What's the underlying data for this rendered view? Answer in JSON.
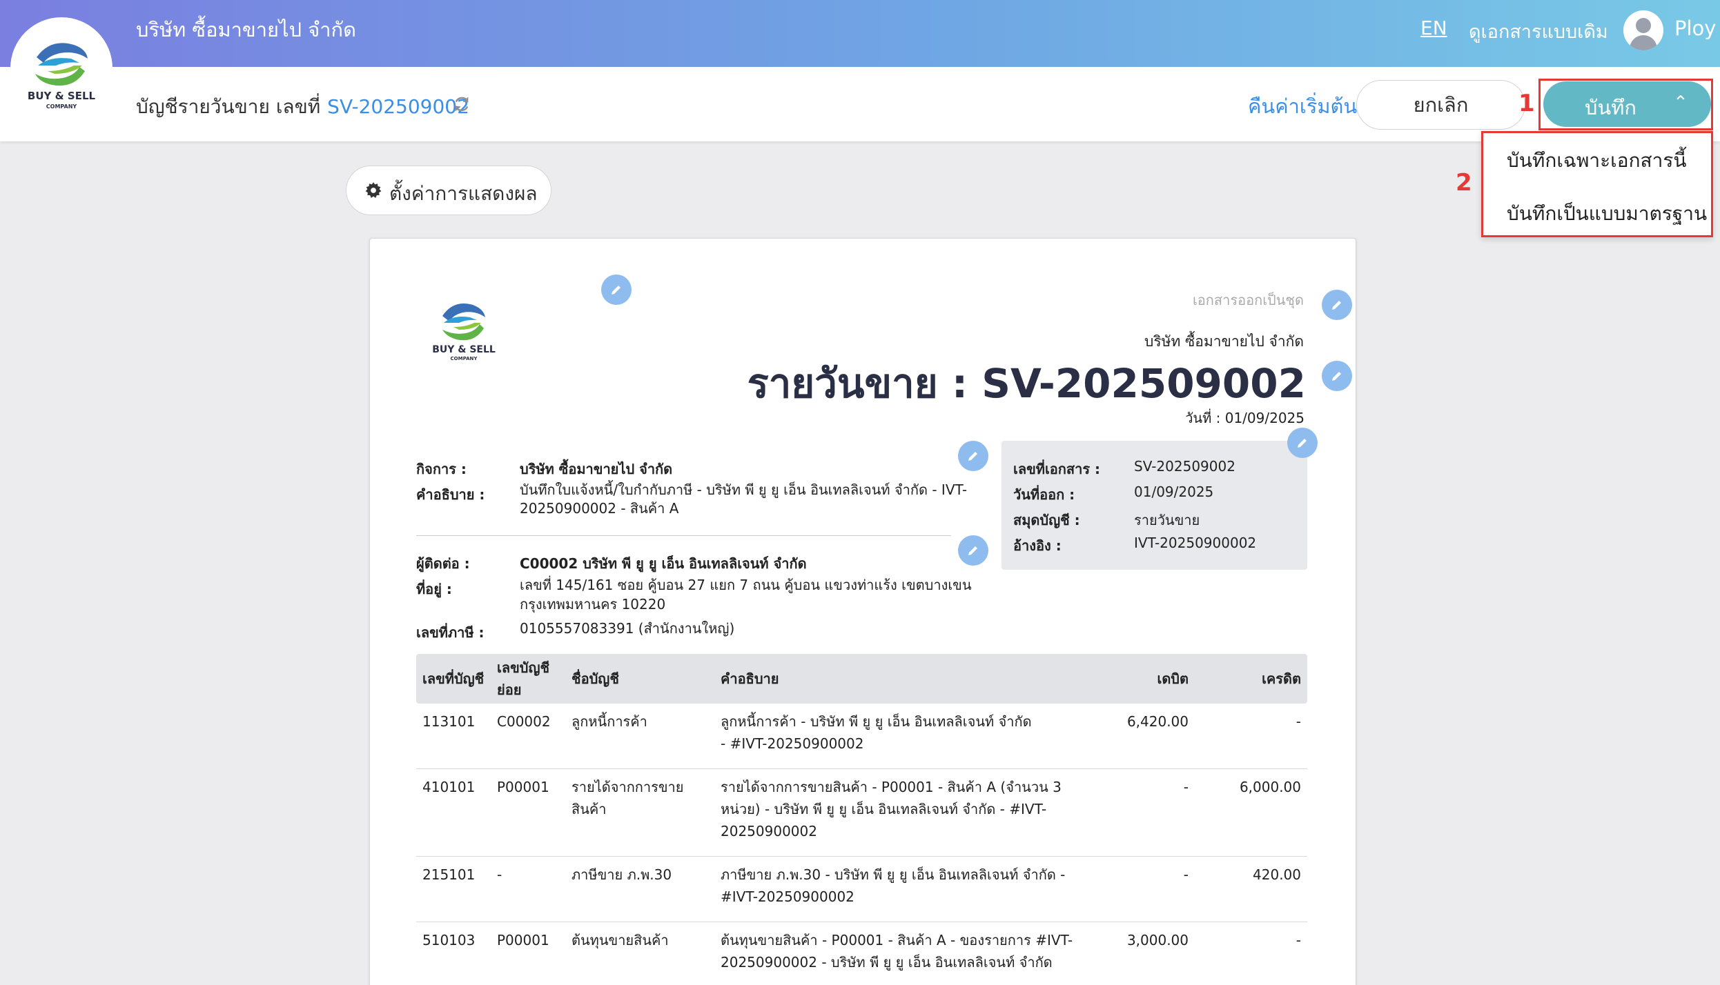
{
  "app": {
    "company_name": "บริษัท ซื้อมาขายไป จำกัด",
    "lang_link": "EN",
    "old_doc_link": "ดูเอกสารแบบเดิม",
    "user_name": "Ploy",
    "logo_text": "BUY & SELL",
    "logo_subtext": "COMPANY"
  },
  "header": {
    "title_prefix": "บัญชีรายวันขาย เลขที่",
    "doc_no": "SV-202509002",
    "reset_label": "คืนค่าเริ่มต้น",
    "cancel_label": "ยกเลิก",
    "save_label": "บันทึก",
    "save_chevron": "⌃"
  },
  "save_menu": {
    "items": [
      "บันทึกเฉพาะเอกสารนี้",
      "บันทึกเป็นแบบมาตรฐาน"
    ]
  },
  "annotations": {
    "num1": "1",
    "num2": "2"
  },
  "settings": {
    "label": "ตั้งค่าการแสดงผล"
  },
  "document": {
    "series_label": "เอกสารออกเป็นชุด",
    "issuer": "บริษัท ซื้อมาขายไป จำกัด",
    "title": "รายวันขาย : SV-202509002",
    "date_line": "วันที่ : 01/09/2025",
    "business_label": "กิจการ :",
    "business_value": "บริษัท ซื้อมาขายไป จำกัด",
    "description_label": "คำอธิบาย :",
    "description_line1": "บันทึกใบแจ้งหนี้/ใบกำกับภาษี - บริษัท พี ยู ยู เอ็น อินเทลลิเจนท์ จำกัด - IVT-",
    "description_line2": "20250900002 - สินค้า A",
    "contact_label": "ผู้ติดต่อ :",
    "contact_value": "C00002 บริษัท พี ยู ยู เอ็น อินเทลลิเจนท์ จำกัด",
    "address_label": "ที่อยู่ :",
    "address_line1": "เลขที่ 145/161     ซอย คู้บอน 27 แยก 7 ถนน คู้บอน  แขวงท่าแร้ง เขตบางเขน",
    "address_line2": "กรุงเทพมหานคร 10220",
    "tax_label": "เลขที่ภาษี :",
    "tax_value": "0105557083391 (สำนักงานใหญ่)",
    "info": {
      "doc_no_label": "เลขที่เอกสาร :",
      "doc_no_value": "SV-202509002",
      "issue_date_label": "วันที่ออก :",
      "issue_date_value": "01/09/2025",
      "journal_label": "สมุดบัญชี :",
      "journal_value": "รายวันขาย",
      "reference_label": "อ้างอิง :",
      "reference_value": "IVT-20250900002"
    },
    "table": {
      "headers": {
        "account_no": "เลขที่บัญชี",
        "sub_account_1": "เลขบัญชี",
        "sub_account_2": "ย่อย",
        "account_name": "ชื่อบัญชี",
        "description": "คำอธิบาย",
        "debit": "เดบิต",
        "credit": "เครดิต"
      },
      "rows": [
        {
          "account_no": "113101",
          "sub_account": "C00002",
          "name_lines": [
            "ลูกหนี้การค้า"
          ],
          "desc_lines": [
            "ลูกหนี้การค้า - บริษัท พี ยู ยู เอ็น อินเทลลิเจนท์ จำกัด",
            "- #IVT-20250900002"
          ],
          "debit": "6,420.00",
          "credit": "-"
        },
        {
          "account_no": "410101",
          "sub_account": "P00001",
          "name_lines": [
            "รายได้จากการขาย",
            "สินค้า"
          ],
          "desc_lines": [
            "รายได้จากการขายสินค้า - P00001 - สินค้า A (จำนวน 3",
            "หน่วย) - บริษัท พี ยู ยู เอ็น อินเทลลิเจนท์ จำกัด - #IVT-",
            "20250900002"
          ],
          "debit": "-",
          "credit": "6,000.00"
        },
        {
          "account_no": "215101",
          "sub_account": "-",
          "name_lines": [
            "ภาษีขาย ภ.พ.30"
          ],
          "desc_lines": [
            "ภาษีขาย ภ.พ.30 - บริษัท พี ยู ยู เอ็น อินเทลลิเจนท์ จำกัด -",
            "#IVT-20250900002"
          ],
          "debit": "-",
          "credit": "420.00"
        },
        {
          "account_no": "510103",
          "sub_account": "P00001",
          "name_lines": [
            "ต้นทุนขายสินค้า"
          ],
          "desc_lines": [
            "ต้นทุนขายสินค้า - P00001 - สินค้า A - ของรายการ #IVT-",
            "20250900002 - บริษัท พี ยู ยู เอ็น อินเทลลิเจนท์ จำกัด"
          ],
          "debit": "3,000.00",
          "credit": "-"
        }
      ]
    }
  },
  "colors": {
    "accent_blue": "#3a8ee6",
    "save_button": "#62b8c4",
    "annotation_red": "#e53935",
    "edit_icon": "#8fbcef"
  },
  "icons": [
    "refresh-icon",
    "gear-icon",
    "pencil-icon",
    "chevron-up-icon",
    "user-avatar-icon"
  ]
}
